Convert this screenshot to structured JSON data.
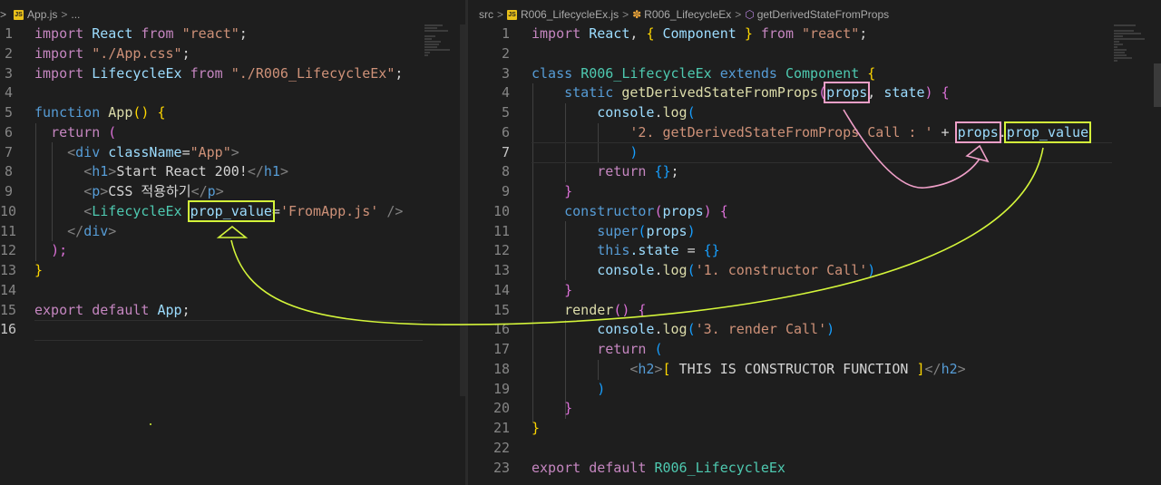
{
  "left": {
    "breadcrumb": {
      "file": "App.js",
      "rest": "..."
    },
    "line_numbers": [
      "1",
      "2",
      "3",
      "4",
      "5",
      "6",
      "7",
      "8",
      "9",
      "10",
      "11",
      "12",
      "13",
      "14",
      "15",
      "16"
    ],
    "code": {
      "l1": {
        "a": "import",
        "b": "React",
        "c": "from",
        "d": "\"react\"",
        "e": ";"
      },
      "l2": {
        "a": "import",
        "d": "\"./App.css\"",
        "e": ";"
      },
      "l3": {
        "a": "import",
        "b": "LifecycleEx",
        "c": "from",
        "d": "\"./R006_LifecycleEx\"",
        "e": ";"
      },
      "l5": {
        "a": "function",
        "b": "App",
        "c": "() {"
      },
      "l6": {
        "a": "return",
        "b": "("
      },
      "l7": {
        "a": "<",
        "b": "div",
        "c": "className",
        "d": "=",
        "e": "\"App\"",
        "f": ">"
      },
      "l8": {
        "a": "<",
        "b": "h1",
        "c": ">",
        "d": "Start React 200!",
        "e": "</",
        "f": "h1",
        "g": ">"
      },
      "l9": {
        "a": "<",
        "b": "p",
        "c": ">",
        "d": "CSS 적용하기",
        "e": "</",
        "f": "p",
        "g": ">"
      },
      "l10": {
        "a": "<",
        "b": "LifecycleEx",
        "c": "prop_value",
        "d": "=",
        "e": "'FromApp.js'",
        "f": "/>"
      },
      "l11": {
        "a": "</",
        "b": "div",
        "c": ">"
      },
      "l12": {
        "a": ");"
      },
      "l13": {
        "a": "}"
      },
      "l15": {
        "a": "export",
        "b": "default",
        "c": "App",
        "d": ";"
      }
    }
  },
  "right": {
    "breadcrumb": {
      "src": "src",
      "file": "R006_LifecycleEx.js",
      "cls": "R006_LifecycleEx",
      "method": "getDerivedStateFromProps"
    },
    "line_numbers": [
      "1",
      "2",
      "3",
      "4",
      "5",
      "6",
      "7",
      "8",
      "9",
      "10",
      "11",
      "12",
      "13",
      "14",
      "15",
      "16",
      "17",
      "18",
      "19",
      "20",
      "21",
      "22",
      "23"
    ],
    "code": {
      "l1": {
        "a": "import",
        "b": "React",
        "c": ",",
        "d": "{",
        "e": "Component",
        "f": "}",
        "g": "from",
        "h": "\"react\"",
        "i": ";"
      },
      "l3": {
        "a": "class",
        "b": "R006_LifecycleEx",
        "c": "extends",
        "d": "Component",
        "e": "{"
      },
      "l4": {
        "a": "static",
        "b": "getDerivedStateFromProps",
        "c": "(",
        "d": "props",
        "e": ", ",
        "f": "state",
        "g": ")",
        "h": "{"
      },
      "l5": {
        "a": "console",
        "b": ".",
        "c": "log",
        "d": "("
      },
      "l6": {
        "a": "'2. getDerivedStateFromProps Call : '",
        "b": "+",
        "c": "props",
        "d": ".",
        "e": "prop_value"
      },
      "l7": {
        "a": ")"
      },
      "l8": {
        "a": "return",
        "b": "{}",
        "c": ";"
      },
      "l9": {
        "a": "}"
      },
      "l10": {
        "a": "constructor",
        "b": "(",
        "c": "props",
        "d": ")",
        "e": "{"
      },
      "l11": {
        "a": "super",
        "b": "(",
        "c": "props",
        "d": ")"
      },
      "l12": {
        "a": "this",
        "b": ".state",
        "c": "=",
        "d": "{}"
      },
      "l13": {
        "a": "console",
        "b": ".",
        "c": "log",
        "d": "(",
        "e": "'1. constructor Call'",
        "f": ")"
      },
      "l14": {
        "a": "}"
      },
      "l15": {
        "a": "render",
        "b": "()",
        "c": "{"
      },
      "l16": {
        "a": "console",
        "b": ".",
        "c": "log",
        "d": "(",
        "e": "'3. render Call'",
        "f": ")"
      },
      "l17": {
        "a": "return",
        "b": "("
      },
      "l18": {
        "a": "<",
        "b": "h2",
        "c": ">",
        "d": "[",
        "e": " THIS IS CONSTRUCTOR FUNCTION ",
        "f": "]",
        "g": "</",
        "h": "h2",
        "i": ">"
      },
      "l19": {
        "a": ")"
      },
      "l20": {
        "a": "}"
      },
      "l21": {
        "a": "}"
      },
      "l23": {
        "a": "export",
        "b": "default",
        "c": "R006_LifecycleEx"
      }
    }
  },
  "colors": {
    "annotation_green": "#d4f53a",
    "annotation_pink": "#ef9fc8",
    "editor_bg": "#1e1e1e"
  }
}
